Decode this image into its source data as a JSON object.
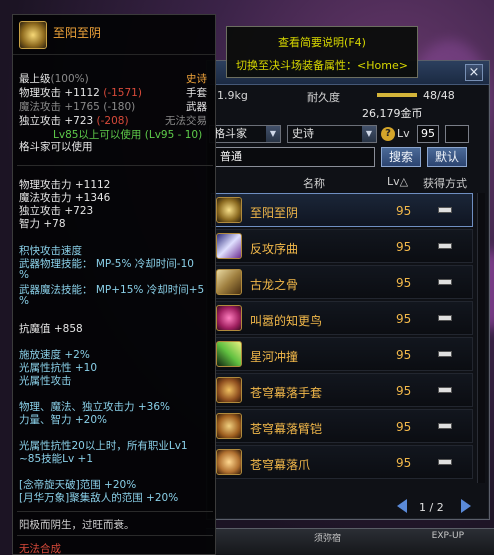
{
  "colors": {
    "accent_gold": "#f0a43a",
    "red": "#d84a3a",
    "green": "#5ecb4a",
    "yellow": "#d8d800"
  },
  "description_box": {
    "line1": "查看简要说明(F4)",
    "line2": "切换至决斗场装备属性：<Home>"
  },
  "equip_window": {
    "close_icon": "close-icon",
    "close_label": "×",
    "weight": "1.9kg",
    "durability_label": "耐久度",
    "durability_value": "48/48",
    "durability_fraction": 1.0,
    "gold": "26,179金币",
    "filter_class": "格斗家",
    "filter_rarity": "史诗",
    "help_label": "?",
    "lv_label": "Lv",
    "lv_value": "95",
    "search_value": "普通",
    "search_button": "搜索",
    "default_button": "默认",
    "columns": {
      "name": "名称",
      "lv": "Lv△",
      "source": "获得方式"
    },
    "rows": [
      {
        "name": "至阳至阴",
        "lv": "95"
      },
      {
        "name": "反攻序曲",
        "lv": "95"
      },
      {
        "name": "古龙之骨",
        "lv": "95"
      },
      {
        "name": "叫嚣的知更鸟",
        "lv": "95"
      },
      {
        "name": "星河冲撞",
        "lv": "95"
      },
      {
        "name": "苍穹幕落手套",
        "lv": "95"
      },
      {
        "name": "苍穹幕落臂铠",
        "lv": "95"
      },
      {
        "name": "苍穹幕落爪",
        "lv": "95"
      }
    ],
    "page": "1 / 2"
  },
  "hud": {
    "tag": "须弥宿",
    "exp": "EXP-UP"
  },
  "tooltip": {
    "title": "至阳至阴",
    "grade": "最上级",
    "grade_pct": "(100%)",
    "rarity": "史诗",
    "phys_atk": "物理攻击",
    "phys_atk_val": "+1112",
    "phys_atk_diff": "(-1571)",
    "phys_type": "手套",
    "mag_atk": "魔法攻击",
    "mag_atk_val": "+1765",
    "mag_atk_diff": "(-180)",
    "mag_type": "武器",
    "ind_atk": "独立攻击",
    "ind_atk_val": "+723",
    "ind_atk_diff": "(-208)",
    "no_trade": "无法交易",
    "lv_req": "Lv85以上可以使用 (Lv95 - 10)",
    "class_req": "格斗家可以使用",
    "stat1": "物理攻击力 +1112",
    "stat2": "魔法攻击力 +1346",
    "stat3": "独立攻击 +723",
    "stat4": "智力 +78",
    "skill_head": "积快攻击速度",
    "skill1a": "武器物理技能：  MP-5% 冷却时间-10",
    "skill1b": "%",
    "skill2a": "武器魔法技能：  MP+15% 冷却时间+5",
    "skill2b": "%",
    "resist": "抗魔值 +858",
    "ext1": "施放速度 +2%",
    "ext2": "光属性抗性 +10",
    "ext3": "光属性攻击",
    "ext4": "物理、魔法、独立攻击力 +36%",
    "ext5": "力量、智力 +20%",
    "ext6": "光属性抗性20以上时，所有职业Lv1",
    "ext7": "~85技能Lv +1",
    "ext8": "[念帝旋天破]范围 +20%",
    "ext9": "[月华万象]聚集敌人的范围 +20%",
    "flavor": "阳极而阴生，过旺而衰。",
    "no_synth": "无法合成"
  }
}
